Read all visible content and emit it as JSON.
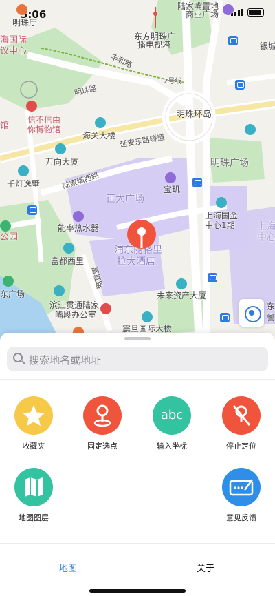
{
  "status": {
    "time": "3:06"
  },
  "map": {
    "labels": {
      "mingzhuting": "明珠厅",
      "lujiazui_mall": "陆家嘴置地",
      "lujiazui_mall2": "商业广场",
      "haiguoji": "海国际",
      "yizhongxin": "议中心",
      "orientalpearl": "东方明珠广",
      "orientalpearl2": "播电视塔",
      "yinyuan": "银城中",
      "fenghelu": "丰和路",
      "line2": "2号线",
      "mingzhulu": "明珠路",
      "xinbuxin": "信不信由",
      "xinbuxin2": "你博物馆",
      "haiguan": "海关大楼",
      "mingzhuhuandao": "明珠环岛",
      "yananroad": "延安东路隧道",
      "wanxiang": "万向大厦",
      "qiandeng": "千灯逸墅",
      "lujiazuixilu": "陆家嘴西路",
      "zhengda": "正大广场",
      "baoji": "宝玑",
      "mingzhuplaza": "明珠广场",
      "nengshuai": "能率热水器",
      "ifc1": "上海国金",
      "ifc2": "中心1期",
      "shanghai_right": "上海",
      "zhongxin_right": "中心",
      "fudu": "富都西里",
      "fuchenglu": "富城路",
      "pudongritz": "浦东丽格里",
      "lada": "拉大酒店",
      "weilaizichan": "未来资产大厦",
      "binjiang1": "滨江贯通陆家",
      "binjiang2": "嘴段办公室",
      "zhendan": "震旦国际大楼",
      "dongyuan": "东",
      "gongyuan": "公园",
      "xiguangchang": "东广场",
      "dongguan": "馆",
      "east": "东",
      "haiyang": "警"
    }
  },
  "search": {
    "placeholder": "搜索地名或地址"
  },
  "actions": [
    {
      "label": "收藏夹",
      "icon": "star-icon",
      "color": "#f7c948"
    },
    {
      "label": "固定选点",
      "icon": "pin-drop-icon",
      "color": "#f0543c"
    },
    {
      "label": "输入坐标",
      "icon": "abc-icon",
      "color": "#34c3a1",
      "glyph": "abc"
    },
    {
      "label": "停止定位",
      "icon": "location-off-icon",
      "color": "#f0543c"
    },
    {
      "label": "地图图层",
      "icon": "map-layers-icon",
      "color": "#34c3a1"
    },
    {
      "label": "意见反馈",
      "icon": "feedback-icon",
      "color": "#2f8fe8"
    }
  ],
  "tabs": {
    "map": "地图",
    "about": "关于"
  }
}
